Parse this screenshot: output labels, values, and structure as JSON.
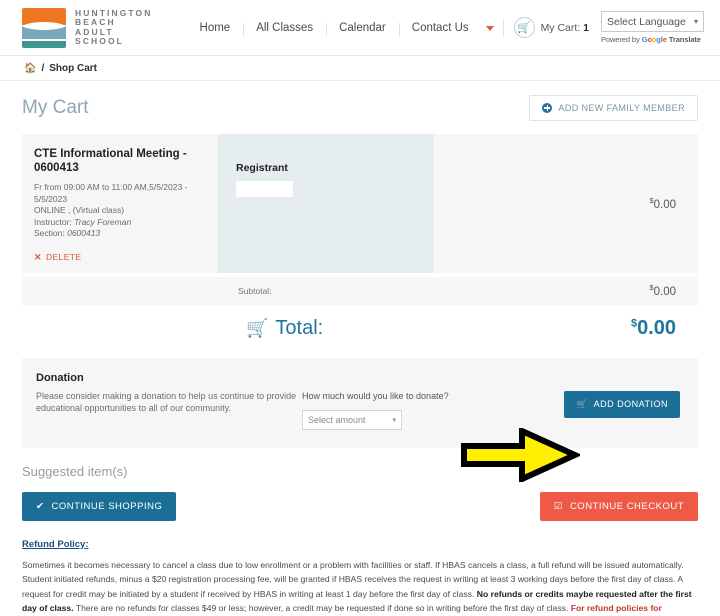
{
  "header": {
    "brand_lines": [
      "HUNTINGTON",
      "BEACH",
      "ADULT",
      "SCHOOL"
    ],
    "nav": [
      {
        "label": "Home"
      },
      {
        "label": "All Classes"
      },
      {
        "label": "Calendar"
      },
      {
        "label": "Contact Us"
      }
    ],
    "cart_label": "My Cart:",
    "cart_count": "1",
    "language_selected": "Select Language",
    "powered_prefix": "Powered by",
    "powered_google": "Google",
    "powered_suffix": "Translate",
    "colors": {
      "logo_orange": "#ef7622",
      "logo_blue": "#7ba7bd",
      "logo_teal": "#3e9691",
      "accent_blue": "#1b6e96",
      "accent_red": "#ef5a47"
    }
  },
  "breadcrumb": {
    "home_icon": "home-icon",
    "separator": "/",
    "current": "Shop Cart"
  },
  "page": {
    "title": "My Cart",
    "add_family_member": "ADD NEW FAMILY MEMBER"
  },
  "cart": {
    "item": {
      "title": "CTE Informational Meeting - 0600413",
      "schedule": "Fr from 09:00 AM to 11:00 AM,5/5/2023 - 5/5/2023",
      "location": "ONLINE , (Virtual class)",
      "instructor_label": "Instructor:",
      "instructor": "Tracy Foreman",
      "section_label": "Section:",
      "section": "0600413",
      "delete_label": "DELETE",
      "price_currency": "$",
      "price": "0.00"
    },
    "registrant_label": "Registrant",
    "registrant_value": "",
    "subtotal_label": "Subtotal:",
    "subtotal_currency": "$",
    "subtotal": "0.00",
    "total_label": "Total:",
    "total_currency": "$",
    "total": "0.00"
  },
  "donation": {
    "title": "Donation",
    "text": "Please consider making a donation to help us continue to provide educational opportunities to all of our community.",
    "question": "How much would you like to donate?",
    "select_value": "Select amount",
    "button": "ADD DONATION"
  },
  "suggested": {
    "heading": "Suggested item(s)"
  },
  "actions": {
    "continue_shopping": "CONTINUE SHOPPING",
    "continue_checkout": "CONTINUE CHECKOUT"
  },
  "refund": {
    "title": "Refund Policy:",
    "p1": "Sometimes it becomes necessary to cancel a class due to low enrollment or a problem with facilities or staff. If HBAS cancels a class, a full refund will be issued automatically. Student initiated refunds, minus a $20 registration processing fee, will be granted if HBAS receives the request in writing at least 3 working days before the first day of class. A request for credit may be initiated by a student if received by HBAS in writing at least 1 day before the first day of class. ",
    "bold1": "No refunds or credits maybe requested after the first day of class.",
    "p2": " There are no refunds for classes $49 or less; however, a credit may be requested if done so in writing before the first day of class. ",
    "red1": "For refund policies for"
  }
}
